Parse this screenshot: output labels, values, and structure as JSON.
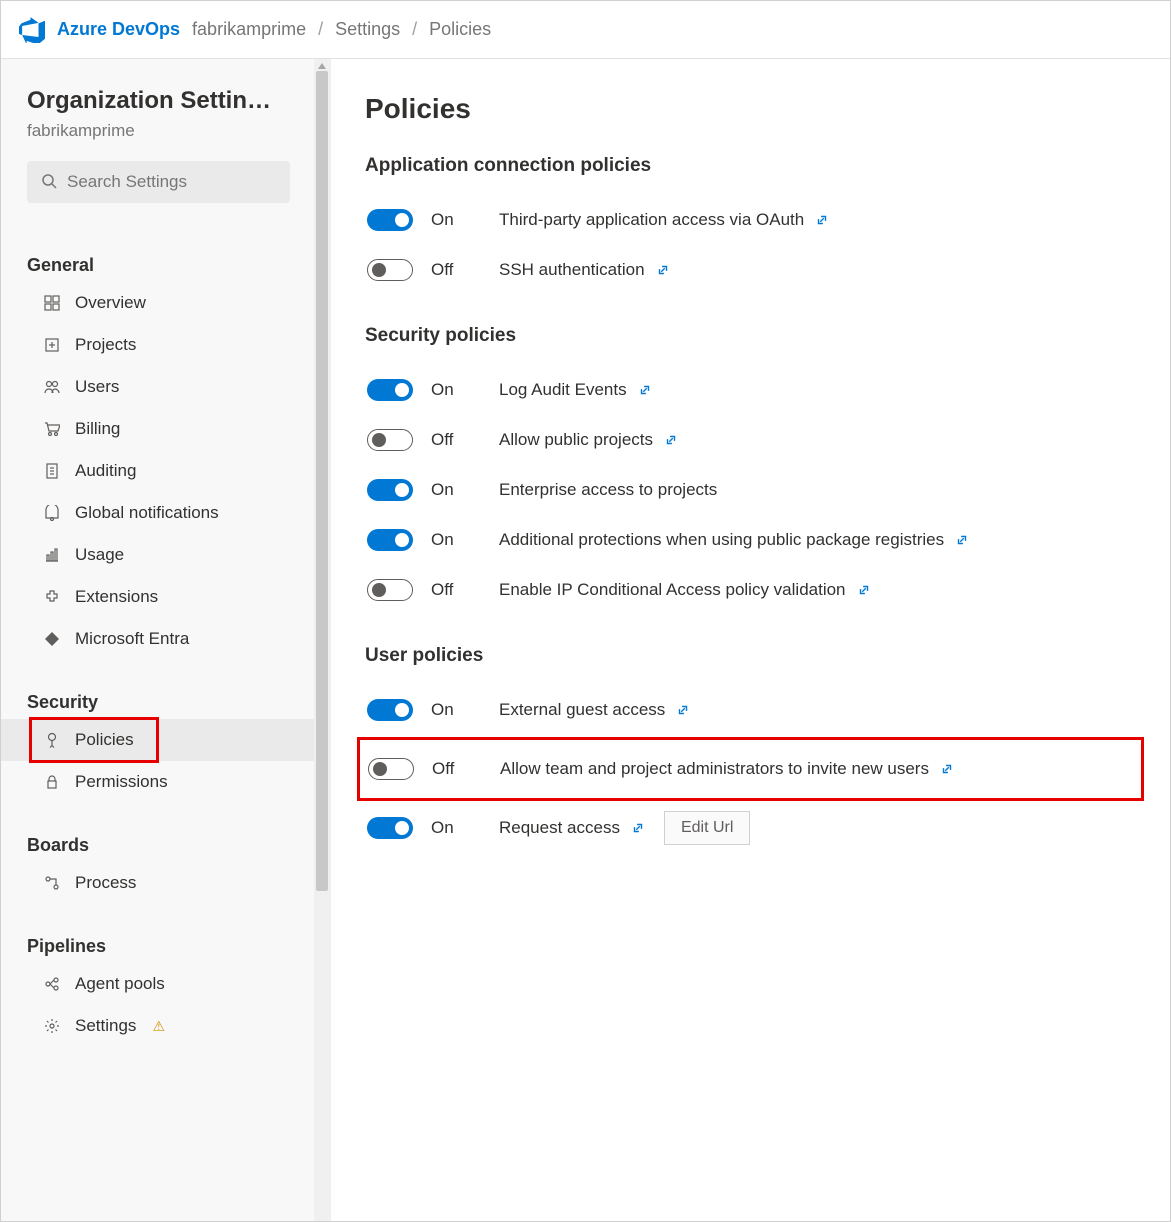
{
  "header": {
    "brand": "Azure DevOps",
    "crumbs": [
      "fabrikamprime",
      "Settings",
      "Policies"
    ]
  },
  "sidebar": {
    "title": "Organization Settin…",
    "subtitle": "fabrikamprime",
    "search_placeholder": "Search Settings",
    "sections": {
      "general": {
        "label": "General",
        "items": [
          "Overview",
          "Projects",
          "Users",
          "Billing",
          "Auditing",
          "Global notifications",
          "Usage",
          "Extensions",
          "Microsoft Entra"
        ]
      },
      "security": {
        "label": "Security",
        "items": [
          "Policies",
          "Permissions"
        ]
      },
      "boards": {
        "label": "Boards",
        "items": [
          "Process"
        ]
      },
      "pipelines": {
        "label": "Pipelines",
        "items": [
          "Agent pools",
          "Settings"
        ]
      }
    }
  },
  "page": {
    "title": "Policies",
    "on_label": "On",
    "off_label": "Off",
    "edit_url_label": "Edit Url",
    "groups": [
      {
        "key": "app",
        "title": "Application connection policies",
        "policies": [
          {
            "label": "Third-party application access via OAuth",
            "on": true,
            "link": true
          },
          {
            "label": "SSH authentication",
            "on": false,
            "link": true
          }
        ]
      },
      {
        "key": "security",
        "title": "Security policies",
        "policies": [
          {
            "label": "Log Audit Events",
            "on": true,
            "link": true
          },
          {
            "label": "Allow public projects",
            "on": false,
            "link": true
          },
          {
            "label": "Enterprise access to projects",
            "on": true,
            "link": false
          },
          {
            "label": "Additional protections when using public package registries",
            "on": true,
            "link": true
          },
          {
            "label": "Enable IP Conditional Access policy validation",
            "on": false,
            "link": true
          }
        ]
      },
      {
        "key": "user",
        "title": "User policies",
        "policies": [
          {
            "label": "External guest access",
            "on": true,
            "link": true
          },
          {
            "label": "Allow team and project administrators to invite new users",
            "on": false,
            "link": true,
            "highlighted": true
          },
          {
            "label": "Request access",
            "on": true,
            "link": true,
            "edit_url": true
          }
        ]
      }
    ]
  }
}
